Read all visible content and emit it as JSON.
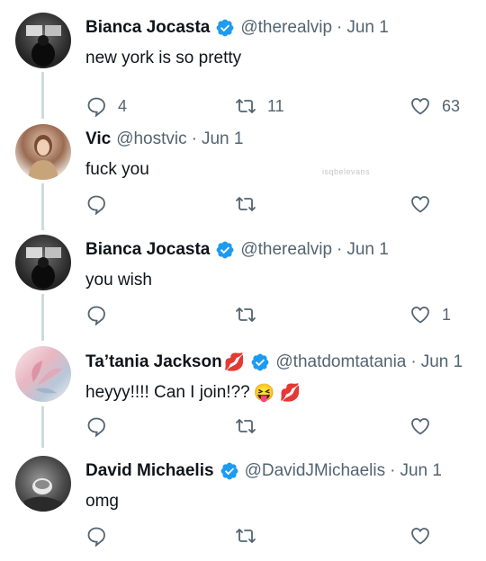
{
  "colors": {
    "text": "#0f1419",
    "muted": "#536471",
    "verified": "#1d9bf0",
    "thread_line": "#cfd9de"
  },
  "watermark": "isqbelevans",
  "tweets": [
    {
      "name": "Bianca Jocasta",
      "verified": true,
      "handle": "@therealvip",
      "date": "Jun 1",
      "text": "new york is so pretty",
      "replies": "4",
      "retweets": "11",
      "likes": "63",
      "avatar": "studio-photo"
    },
    {
      "name": "Vic",
      "verified": false,
      "handle": "@hostvic",
      "date": "Jun 1",
      "text": "fuck you",
      "replies": "",
      "retweets": "",
      "likes": "",
      "avatar": "woman-portrait"
    },
    {
      "name": "Bianca Jocasta",
      "verified": true,
      "handle": "@therealvip",
      "date": "Jun 1",
      "text": "you wish",
      "replies": "",
      "retweets": "",
      "likes": "1",
      "avatar": "studio-photo"
    },
    {
      "name": "Ta’tania Jackson",
      "name_emoji": "💋",
      "verified": true,
      "handle": "@thatdomtatania",
      "date": "Jun 1",
      "text": "heyyy!!!! Can I join!??",
      "text_emoji": "😝 💋",
      "replies": "",
      "retweets": "",
      "likes": "",
      "avatar": "butterfly-art"
    },
    {
      "name": "David Michaelis",
      "verified": true,
      "handle": "@DavidJMichaelis",
      "date": "Jun 1",
      "text": "omg",
      "replies": "",
      "retweets": "",
      "likes": "",
      "avatar": "coffee-cup-photo"
    }
  ],
  "separator": "·"
}
